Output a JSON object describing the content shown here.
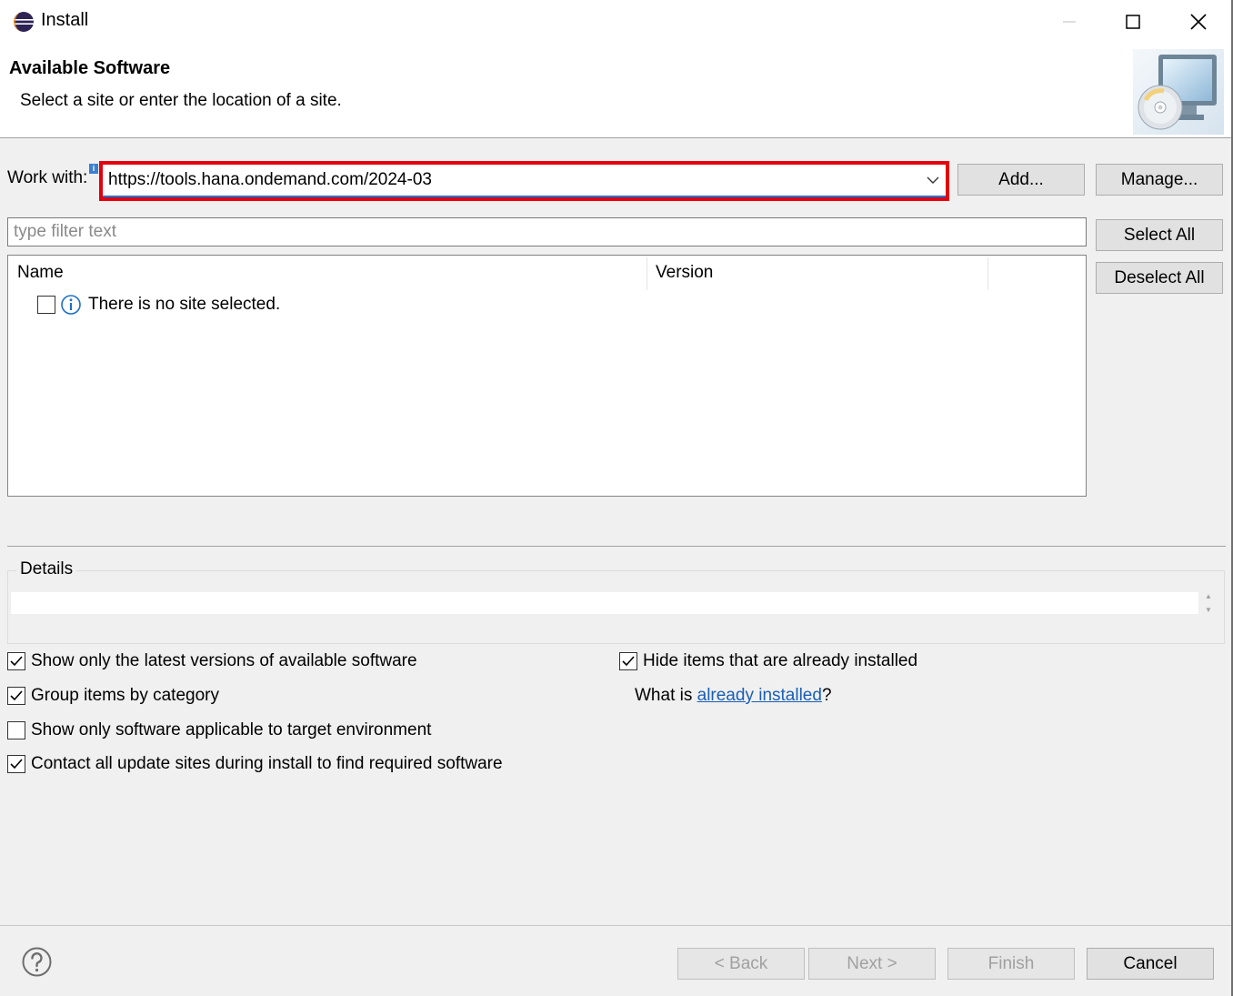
{
  "window": {
    "title": "Install"
  },
  "header": {
    "title": "Available Software",
    "subtitle": "Select a site or enter the location of a site."
  },
  "work_with": {
    "label": "Work with:",
    "value": "https://tools.hana.ondemand.com/2024-03",
    "add_label": "Add...",
    "manage_label": "Manage..."
  },
  "filter": {
    "placeholder": "type filter text"
  },
  "table": {
    "columns": [
      "Name",
      "Version"
    ],
    "message": "There is no site selected."
  },
  "side_buttons": {
    "select_all": "Select All",
    "deselect_all": "Deselect All"
  },
  "details": {
    "label": "Details"
  },
  "options": {
    "latest_versions": {
      "label": "Show only the latest versions of available software",
      "checked": true
    },
    "group_by_category": {
      "label": "Group items by category",
      "checked": true
    },
    "target_env": {
      "label": "Show only software applicable to target environment",
      "checked": false
    },
    "contact_sites": {
      "label": "Contact all update sites during install to find required software",
      "checked": true
    },
    "hide_installed": {
      "label": "Hide items that are already installed",
      "checked": true
    },
    "what_is_prefix": "What is ",
    "what_is_link": "already installed",
    "what_is_suffix": "?"
  },
  "footer": {
    "back": "< Back",
    "next": "Next >",
    "finish": "Finish",
    "cancel": "Cancel"
  },
  "colors": {
    "highlight": "#e3000f",
    "link": "#1a5fb4",
    "focus": "#0078d7"
  }
}
